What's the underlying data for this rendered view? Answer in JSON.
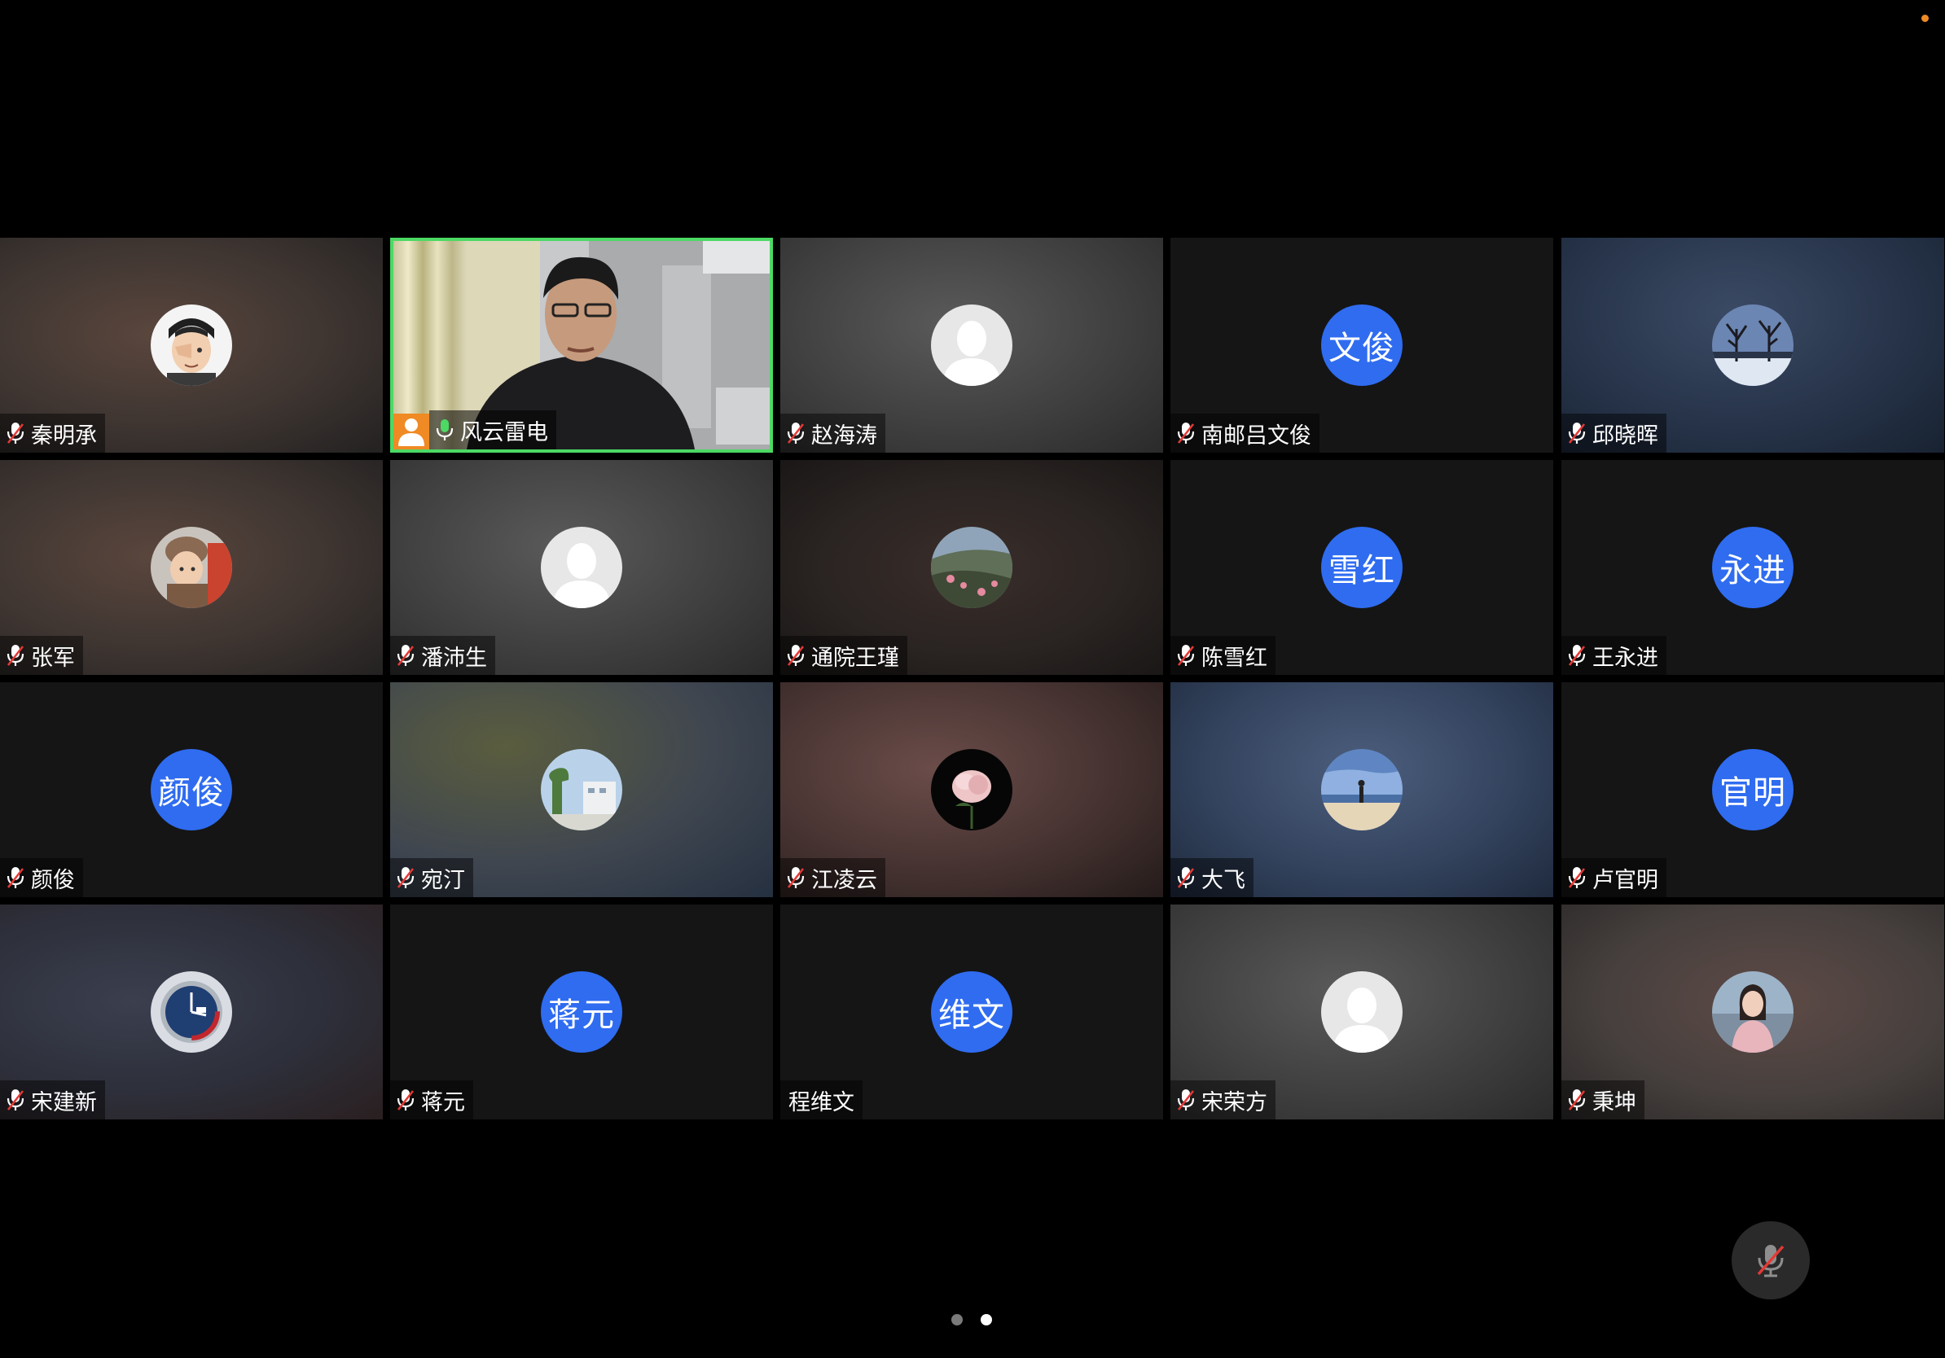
{
  "participants": [
    {
      "name": "秦明承",
      "avatar": "cartoon-face-photo",
      "background": "warm",
      "muted": true
    },
    {
      "name": "风云雷电",
      "avatar": "live-video",
      "background": "video",
      "muted": false,
      "speaking": true,
      "host": true
    },
    {
      "name": "赵海涛",
      "avatar": "default-user",
      "background": "gray",
      "muted": true
    },
    {
      "name": "南邮吕文俊",
      "initials": "文俊",
      "background": "plain",
      "muted": true
    },
    {
      "name": "邱晓晖",
      "avatar": "winter-tree-photo",
      "background": "blue",
      "muted": true
    },
    {
      "name": "张军",
      "avatar": "child-photo",
      "background": "warm",
      "muted": true
    },
    {
      "name": "潘沛生",
      "avatar": "default-user",
      "background": "gray",
      "muted": true
    },
    {
      "name": "通院王瑾",
      "avatar": "landscape-photo",
      "background": "dark",
      "muted": true
    },
    {
      "name": "陈雪红",
      "initials": "雪红",
      "background": "plain",
      "muted": true
    },
    {
      "name": "王永进",
      "initials": "永进",
      "background": "plain",
      "muted": true
    },
    {
      "name": "颜俊",
      "initials": "颜俊",
      "background": "plain",
      "muted": true
    },
    {
      "name": "宛汀",
      "avatar": "building-photo",
      "background": "green",
      "muted": true
    },
    {
      "name": "江凌云",
      "avatar": "rose-photo",
      "background": "rose",
      "muted": true
    },
    {
      "name": "大飞",
      "avatar": "beach-photo",
      "background": "sky",
      "muted": true
    },
    {
      "name": "卢官明",
      "initials": "官明",
      "background": "plain",
      "muted": true
    },
    {
      "name": "宋建新",
      "avatar": "watch-photo",
      "background": "watch",
      "muted": true
    },
    {
      "name": "蒋元",
      "initials": "蒋元",
      "background": "plain",
      "muted": true
    },
    {
      "name": "程维文",
      "initials": "维文",
      "background": "plain",
      "muted": false
    },
    {
      "name": "宋荣方",
      "avatar": "default-user",
      "background": "gray",
      "muted": true
    },
    {
      "name": "秉坤",
      "avatar": "woman-photo",
      "background": "lady",
      "muted": true
    }
  ],
  "pagination": {
    "current_page": 2,
    "total_pages": 2
  },
  "controls": {
    "mute_button": "microphone-muted-icon"
  },
  "colors": {
    "speaking_border": "#4cd964",
    "initials_avatar": "#2f6cf0",
    "host_badge": "#f08a24"
  }
}
